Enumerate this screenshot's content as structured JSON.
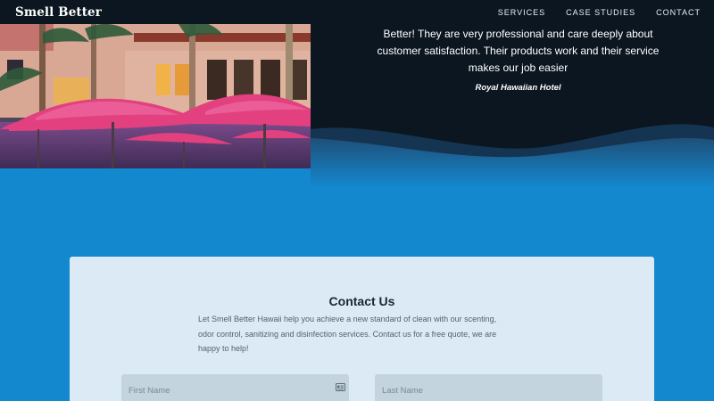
{
  "site": {
    "brand": "Smell Better"
  },
  "nav": {
    "items": [
      {
        "label": "SERVICES"
      },
      {
        "label": "CASE STUDIES"
      },
      {
        "label": "CONTACT"
      }
    ]
  },
  "testimonial": {
    "quote_lines": [
      "Better! They are very professional and care deeply about",
      "customer satisfaction. Their products work and their service",
      "makes our job easier"
    ],
    "author": "Royal Hawaiian Hotel"
  },
  "contact": {
    "title": "Contact Us",
    "description_lines": [
      "Let Smell Better Hawaii help you achieve a new standard of clean with our scenting,",
      "odor control, sanitizing and disinfection services. Contact us for a free quote, we are",
      "happy to help!"
    ],
    "first_name_placeholder": "First Name",
    "last_name_placeholder": "Last Name",
    "first_name_icon": "contact-card-icon"
  },
  "colors": {
    "nav_bg": "#0b1620",
    "page_blue": "#1388cf",
    "card_bg": "#dceaf6",
    "umbrella_pink": "#e2407f"
  }
}
